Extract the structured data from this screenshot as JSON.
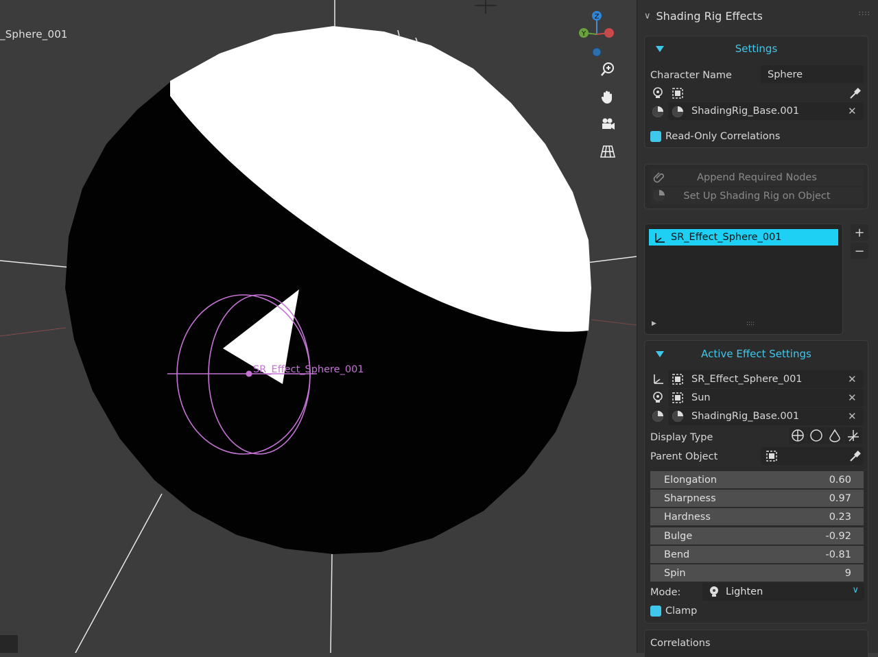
{
  "viewport": {
    "object_label": "_Sphere_001",
    "effect_label": "SR_Effect_Sphere_001",
    "gizmo_axes": {
      "z": "Z",
      "y": "Y"
    },
    "nav_icons": [
      "zoom-icon",
      "hand-pan-icon",
      "camera-icon",
      "grid-view-icon"
    ]
  },
  "panel": {
    "title": "Shading Rig Effects",
    "settings": {
      "title": "Settings",
      "character_name_label": "Character Name",
      "character_name_value": "Sphere",
      "base_material": "ShadingRig_Base.001",
      "read_only_label": "Read-Only Correlations"
    },
    "buttons": {
      "append": "Append Required Nodes",
      "setup": "Set Up Shading Rig on Object"
    },
    "effects_list": {
      "items": [
        "SR_Effect_Sphere_001"
      ],
      "add": "+",
      "remove": "−"
    },
    "active": {
      "title": "Active Effect Settings",
      "effect_object": "SR_Effect_Sphere_001",
      "light": "Sun",
      "material": "ShadingRig_Base.001",
      "display_type_label": "Display Type",
      "parent_object_label": "Parent Object",
      "sliders": [
        {
          "label": "Elongation",
          "value": "0.60"
        },
        {
          "label": "Sharpness",
          "value": "0.97"
        },
        {
          "label": "Hardness",
          "value": "0.23"
        },
        {
          "label": "Bulge",
          "value": "-0.92"
        },
        {
          "label": "Bend",
          "value": "-0.81"
        },
        {
          "label": "Spin",
          "value": "9"
        }
      ],
      "mode_label": "Mode:",
      "mode_value": "Lighten",
      "clamp_label": "Clamp"
    },
    "correlations": {
      "title": "Correlations"
    }
  },
  "colors": {
    "accent": "#3fc8ec",
    "selection": "#1fd0f5",
    "effect_wire": "#c673d6"
  }
}
